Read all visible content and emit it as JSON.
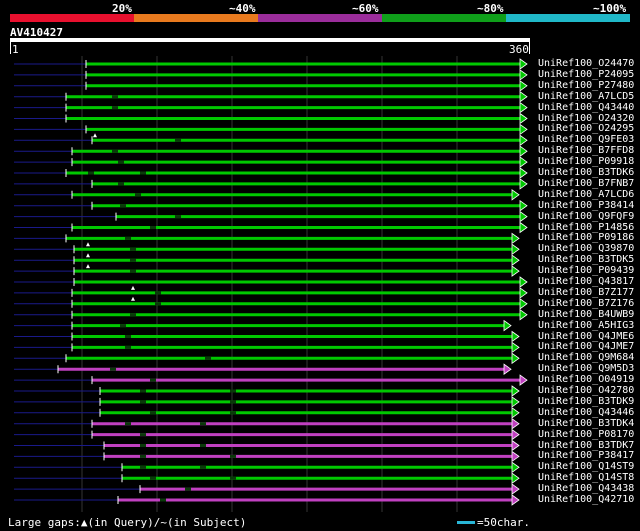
{
  "header": {
    "percent_labels": [
      "20%",
      "~40%",
      "~60%",
      "~80%",
      "~100%"
    ],
    "color_bands": [
      "#e8102e",
      "#e87a1e",
      "#9b2d9b",
      "#0f9f1a",
      "#20b8c8"
    ]
  },
  "query": {
    "title": "AV410427",
    "start": "1",
    "end": "360"
  },
  "colors": {
    "green": "#00c800",
    "purple": "#c040c0",
    "blue_leader": "#1a1a8a",
    "gridline": "#333333"
  },
  "hits": [
    {
      "label": "UniRef100_O24470",
      "color": "green"
    },
    {
      "label": "UniRef100_P24095",
      "color": "green"
    },
    {
      "label": "UniRef100_P27480",
      "color": "green"
    },
    {
      "label": "UniRef100_A7LCD5",
      "color": "green"
    },
    {
      "label": "UniRef100_Q43440",
      "color": "green"
    },
    {
      "label": "UniRef100_O24320",
      "color": "green"
    },
    {
      "label": "UniRef100_O24295",
      "color": "green"
    },
    {
      "label": "UniRef100_Q9FE03",
      "color": "green"
    },
    {
      "label": "UniRef100_B7FFD8",
      "color": "green"
    },
    {
      "label": "UniRef100_P09918",
      "color": "green"
    },
    {
      "label": "UniRef100_B3TDK6",
      "color": "green"
    },
    {
      "label": "UniRef100_B7FNB7",
      "color": "green"
    },
    {
      "label": "UniRef100_A7LCD6",
      "color": "green"
    },
    {
      "label": "UniRef100_P38414",
      "color": "green"
    },
    {
      "label": "UniRef100_Q9FQF9",
      "color": "green"
    },
    {
      "label": "UniRef100_P14856",
      "color": "green"
    },
    {
      "label": "UniRef100_P09186",
      "color": "green"
    },
    {
      "label": "UniRef100_Q39870",
      "color": "green"
    },
    {
      "label": "UniRef100_B3TDK5",
      "color": "green"
    },
    {
      "label": "UniRef100_P09439",
      "color": "green"
    },
    {
      "label": "UniRef100_Q43817",
      "color": "green"
    },
    {
      "label": "UniRef100_B7Z177",
      "color": "green"
    },
    {
      "label": "UniRef100_B7Z176",
      "color": "green"
    },
    {
      "label": "UniRef100_B4UWB9",
      "color": "green"
    },
    {
      "label": "UniRef100_A5HIG3",
      "color": "green"
    },
    {
      "label": "UniRef100_Q4JME6",
      "color": "green"
    },
    {
      "label": "UniRef100_Q4JME7",
      "color": "green"
    },
    {
      "label": "UniRef100_Q9M684",
      "color": "green"
    },
    {
      "label": "UniRef100_Q9M5D3",
      "color": "purple"
    },
    {
      "label": "UniRef100_O04919",
      "color": "purple"
    },
    {
      "label": "UniRef100_O42780",
      "color": "green"
    },
    {
      "label": "UniRef100_B3TDK9",
      "color": "green"
    },
    {
      "label": "UniRef100_Q43446",
      "color": "green"
    },
    {
      "label": "UniRef100_B3TDK4",
      "color": "purple"
    },
    {
      "label": "UniRef100_P08170",
      "color": "purple"
    },
    {
      "label": "UniRef100_B3TDK7",
      "color": "purple"
    },
    {
      "label": "UniRef100_P38417",
      "color": "purple"
    },
    {
      "label": "UniRef100_Q14ST9",
      "color": "green"
    },
    {
      "label": "UniRef100_Q14ST8",
      "color": "green"
    },
    {
      "label": "UniRef100_Q43438",
      "color": "purple"
    },
    {
      "label": "UniRef100_Q42710",
      "color": "purple"
    }
  ],
  "footer": {
    "gaps_text": "Large gaps:▲(in Query)/~(in Subject)",
    "scale_text": "=50char."
  }
}
